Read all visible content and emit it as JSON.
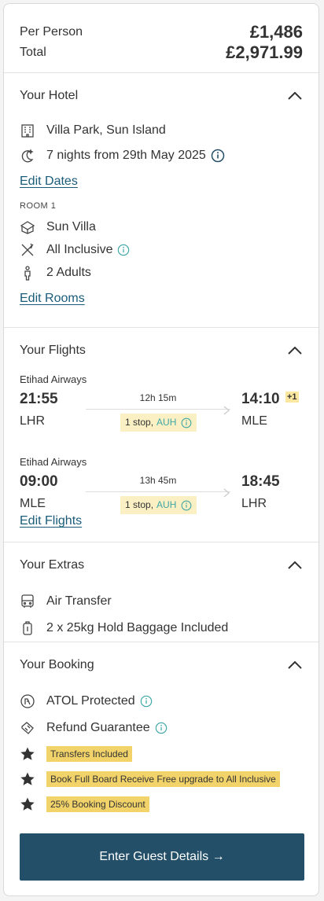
{
  "price": {
    "per_person_label": "Per Person",
    "per_person_value": "£1,486",
    "total_label": "Total",
    "total_value": "£2,971.99"
  },
  "hotel": {
    "title": "Your Hotel",
    "name": "Villa Park, Sun Island",
    "nights": "7 nights from 29th May 2025",
    "edit_dates": "Edit Dates",
    "room_label": "ROOM 1",
    "room_type": "Sun Villa",
    "board": "All Inclusive",
    "guests": "2 Adults",
    "edit_rooms": "Edit Rooms"
  },
  "flights": {
    "title": "Your Flights",
    "outbound": {
      "airline": "Etihad Airways",
      "dep_time": "21:55",
      "dep_code": "LHR",
      "duration": "12h 15m",
      "stops": "1 stop,",
      "hub": "AUH",
      "arr_time": "14:10",
      "arr_code": "MLE",
      "day_offset": "+1"
    },
    "inbound": {
      "airline": "Etihad Airways",
      "dep_time": "09:00",
      "dep_code": "MLE",
      "duration": "13h 45m",
      "stops": "1 stop,",
      "hub": "AUH",
      "arr_time": "18:45",
      "arr_code": "LHR"
    },
    "edit_flights": "Edit Flights"
  },
  "extras": {
    "title": "Your Extras",
    "transfer": "Air Transfer",
    "baggage": "2 x 25kg Hold Baggage Included"
  },
  "booking": {
    "title": "Your Booking",
    "atol": "ATOL Protected",
    "refund": "Refund Guarantee",
    "badges": [
      "Transfers Included",
      "Book Full Board Receive Free upgrade to All Inclusive",
      "25% Booking Discount"
    ]
  },
  "cta": {
    "label": "Enter Guest Details →"
  },
  "colors": {
    "accent": "#235068",
    "link": "#1a5b7a",
    "badge": "#f2d36a",
    "info": "#3fa6a6"
  }
}
